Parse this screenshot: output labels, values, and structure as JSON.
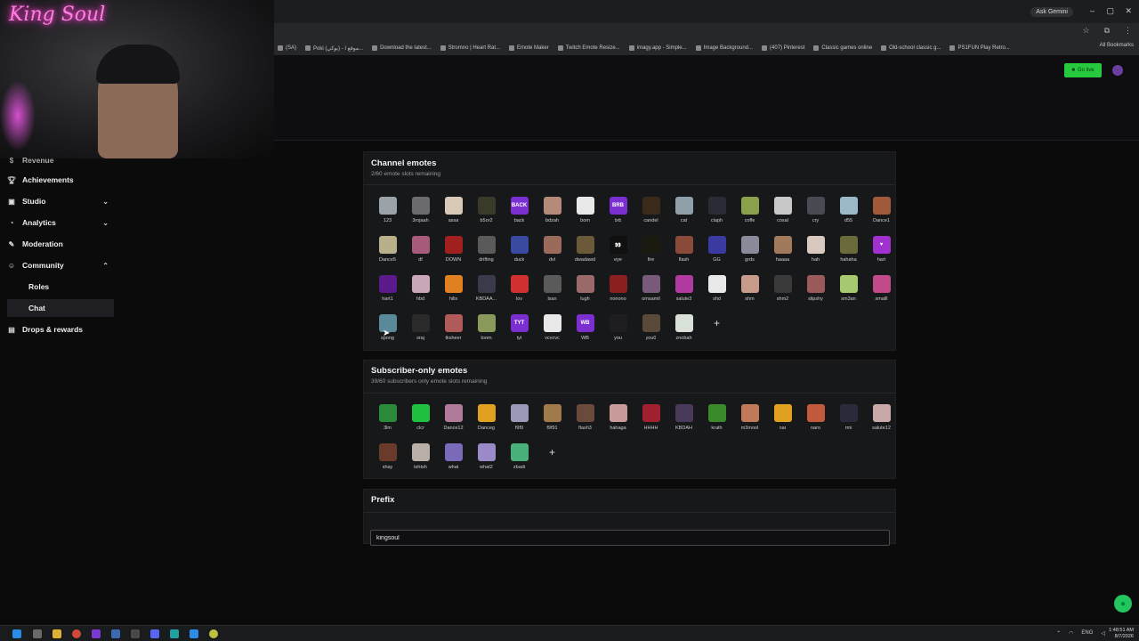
{
  "browser": {
    "ask_gemini": "Ask Gemini",
    "bookmarks": [
      "(SA)",
      "Poki (بوكي) - موقع ا...",
      "Download the latest...",
      "Stromno | Heart Rat...",
      "Emote Maker",
      "Twitch Emote Resize...",
      "imagy.app - Simple...",
      "Image Background...",
      "(407) Pinterest",
      "Classic games online",
      "Old-school classic g...",
      "PS1FUN Play Retro..."
    ],
    "all_bookmarks": "All Bookmarks"
  },
  "webcam": {
    "logo_text": "King Soul"
  },
  "header": {
    "go_live": "Go live"
  },
  "sidebar": {
    "items": [
      {
        "label": "Revenue",
        "icon": "revenue-icon"
      },
      {
        "label": "Achievements",
        "icon": "trophy-icon"
      },
      {
        "label": "Studio",
        "icon": "studio-icon",
        "expandable": true
      },
      {
        "label": "Analytics",
        "icon": "analytics-icon",
        "expandable": true
      },
      {
        "label": "Moderation",
        "icon": "wrench-icon"
      },
      {
        "label": "Community",
        "icon": "community-icon",
        "expanded": true
      }
    ],
    "subitems": [
      {
        "label": "Roles",
        "active": false
      },
      {
        "label": "Chat",
        "active": true
      }
    ],
    "drops": {
      "label": "Drops & rewards",
      "icon": "gift-icon"
    }
  },
  "channel_emotes": {
    "title": "Channel emotes",
    "subtitle": "2/60 emote slots remaining",
    "items": [
      {
        "name": "123",
        "color": "#9aa3a8",
        "glyph": ""
      },
      {
        "name": "3rojaah",
        "color": "#6b6b70",
        "glyph": ""
      },
      {
        "name": "assa",
        "color": "#d9c7b8",
        "glyph": ""
      },
      {
        "name": "b5or2",
        "color": "#3a3a2a",
        "glyph": ""
      },
      {
        "name": "back",
        "color": "#7b2fd0",
        "glyph": "BACK"
      },
      {
        "name": "bdzah",
        "color": "#b58a7a",
        "glyph": ""
      },
      {
        "name": "bom",
        "color": "#e8e8e8",
        "glyph": ""
      },
      {
        "name": "brb",
        "color": "#7b2fd0",
        "glyph": "BRB"
      },
      {
        "name": "candel",
        "color": "#3a2a1a",
        "glyph": ""
      },
      {
        "name": "cat",
        "color": "#8fa0a8",
        "glyph": ""
      },
      {
        "name": "claph",
        "color": "#2b2b35",
        "glyph": ""
      },
      {
        "name": "coffe",
        "color": "#8aa04a",
        "glyph": ""
      },
      {
        "name": "cosal",
        "color": "#c8c8c8",
        "glyph": ""
      },
      {
        "name": "cry",
        "color": "#4a4a55",
        "glyph": ""
      },
      {
        "name": "d55",
        "color": "#9ab8c8",
        "glyph": ""
      },
      {
        "name": "Dance1",
        "color": "#a05a3a",
        "glyph": ""
      },
      {
        "name": "Dance5",
        "color": "#b8b08a",
        "glyph": ""
      },
      {
        "name": "df",
        "color": "#a85a7a",
        "glyph": ""
      },
      {
        "name": "DOWN",
        "color": "#a02020",
        "glyph": ""
      },
      {
        "name": "drifting",
        "color": "#5a5a5a",
        "glyph": ""
      },
      {
        "name": "duck",
        "color": "#3a4aa0",
        "glyph": ""
      },
      {
        "name": "dvl",
        "color": "#9a6a5a",
        "glyph": ""
      },
      {
        "name": "dwadawd",
        "color": "#6a5a3a",
        "glyph": ""
      },
      {
        "name": "eye",
        "color": "#101010",
        "glyph": "👀"
      },
      {
        "name": "fire",
        "color": "#1a1a10",
        "glyph": ""
      },
      {
        "name": "flash",
        "color": "#8a4a3a",
        "glyph": ""
      },
      {
        "name": "GG",
        "color": "#3a3aa0",
        "glyph": ""
      },
      {
        "name": "grds",
        "color": "#8a8a9a",
        "glyph": ""
      },
      {
        "name": "haaaa",
        "color": "#a07a5a",
        "glyph": ""
      },
      {
        "name": "hah",
        "color": "#d8c8c0",
        "glyph": ""
      },
      {
        "name": "hahaha",
        "color": "#6a6a3a",
        "glyph": ""
      },
      {
        "name": "hart",
        "color": "#a030d0",
        "glyph": "♥"
      },
      {
        "name": "hart1",
        "color": "#5a1a8a",
        "glyph": ""
      },
      {
        "name": "hbd",
        "color": "#c8a8b8",
        "glyph": ""
      },
      {
        "name": "hilix",
        "color": "#e08020",
        "glyph": ""
      },
      {
        "name": "KBDAA...",
        "color": "#3a3a4a",
        "glyph": ""
      },
      {
        "name": "lov",
        "color": "#d03030",
        "glyph": ""
      },
      {
        "name": "lsan",
        "color": "#5a5a5a",
        "glyph": ""
      },
      {
        "name": "lugh",
        "color": "#9a6a6a",
        "glyph": ""
      },
      {
        "name": "nonono",
        "color": "#8a2020",
        "glyph": ""
      },
      {
        "name": "omsamil",
        "color": "#7a5a7a",
        "glyph": ""
      },
      {
        "name": "salute3",
        "color": "#b03aa0",
        "glyph": ""
      },
      {
        "name": "shd",
        "color": "#e8e8e8",
        "glyph": ""
      },
      {
        "name": "shm",
        "color": "#c89a8a",
        "glyph": ""
      },
      {
        "name": "shm2",
        "color": "#3a3a3a",
        "glyph": ""
      },
      {
        "name": "slipshy",
        "color": "#9a5a5a",
        "glyph": ""
      },
      {
        "name": "sm3an",
        "color": "#a8c870",
        "glyph": ""
      },
      {
        "name": "smalll",
        "color": "#c04a8a",
        "glyph": ""
      },
      {
        "name": "spong",
        "color": "#5a8a9a",
        "glyph": ""
      },
      {
        "name": "sraj",
        "color": "#2a2a2a",
        "glyph": ""
      },
      {
        "name": "tksheer",
        "color": "#b05a5a",
        "glyph": ""
      },
      {
        "name": "toom",
        "color": "#8a9a5a",
        "glyph": ""
      },
      {
        "name": "tyt",
        "color": "#7b2fd0",
        "glyph": "TYT"
      },
      {
        "name": "vcvcvc",
        "color": "#e8e8e8",
        "glyph": ""
      },
      {
        "name": "WB",
        "color": "#7b2fd0",
        "glyph": "WB"
      },
      {
        "name": "you",
        "color": "#1e1e22",
        "glyph": ""
      },
      {
        "name": "you0",
        "color": "#5a4a3a",
        "glyph": ""
      },
      {
        "name": "znobah",
        "color": "#d8e0d8",
        "glyph": ""
      }
    ],
    "add_label": "+"
  },
  "subscriber_emotes": {
    "title": "Subscriber-only emotes",
    "subtitle": "39/60 subscribers only emote slots remaining",
    "items": [
      {
        "name": "3lm",
        "color": "#2a8a3a",
        "glyph": ""
      },
      {
        "name": "clcr",
        "color": "#20c040",
        "glyph": ""
      },
      {
        "name": "Dance12",
        "color": "#b07a9a",
        "glyph": ""
      },
      {
        "name": "Danceg",
        "color": "#e0a020",
        "glyph": ""
      },
      {
        "name": "f9f9",
        "color": "#9a9ab8",
        "glyph": ""
      },
      {
        "name": "f9f91",
        "color": "#a07a4a",
        "glyph": ""
      },
      {
        "name": "flash3",
        "color": "#6a4a3a",
        "glyph": ""
      },
      {
        "name": "hahaga",
        "color": "#c89a9a",
        "glyph": ""
      },
      {
        "name": "HHHH",
        "color": "#a02030",
        "glyph": ""
      },
      {
        "name": "KBDAH",
        "color": "#4a3a5a",
        "glyph": ""
      },
      {
        "name": "krath",
        "color": "#3a8a2a",
        "glyph": ""
      },
      {
        "name": "m3mool",
        "color": "#c07a5a",
        "glyph": ""
      },
      {
        "name": "nar",
        "color": "#e0a020",
        "glyph": ""
      },
      {
        "name": "naro",
        "color": "#c05a3a",
        "glyph": ""
      },
      {
        "name": "rmi",
        "color": "#2a2a3a",
        "glyph": ""
      },
      {
        "name": "salute12",
        "color": "#c8a8a8",
        "glyph": ""
      },
      {
        "name": "shay",
        "color": "#6a3a2a",
        "glyph": ""
      },
      {
        "name": "tshtsh",
        "color": "#b8b0a8",
        "glyph": ""
      },
      {
        "name": "what",
        "color": "#7a6ab8",
        "glyph": ""
      },
      {
        "name": "what2",
        "color": "#9a8ac8",
        "glyph": ""
      },
      {
        "name": "zbadi",
        "color": "#4ab07a",
        "glyph": ""
      }
    ],
    "add_label": "+"
  },
  "prefix": {
    "title": "Prefix",
    "value": "kingsoul"
  },
  "taskbar": {
    "lang": "ENG",
    "time": "1:48:51 AM",
    "date": "8/7/2026"
  }
}
